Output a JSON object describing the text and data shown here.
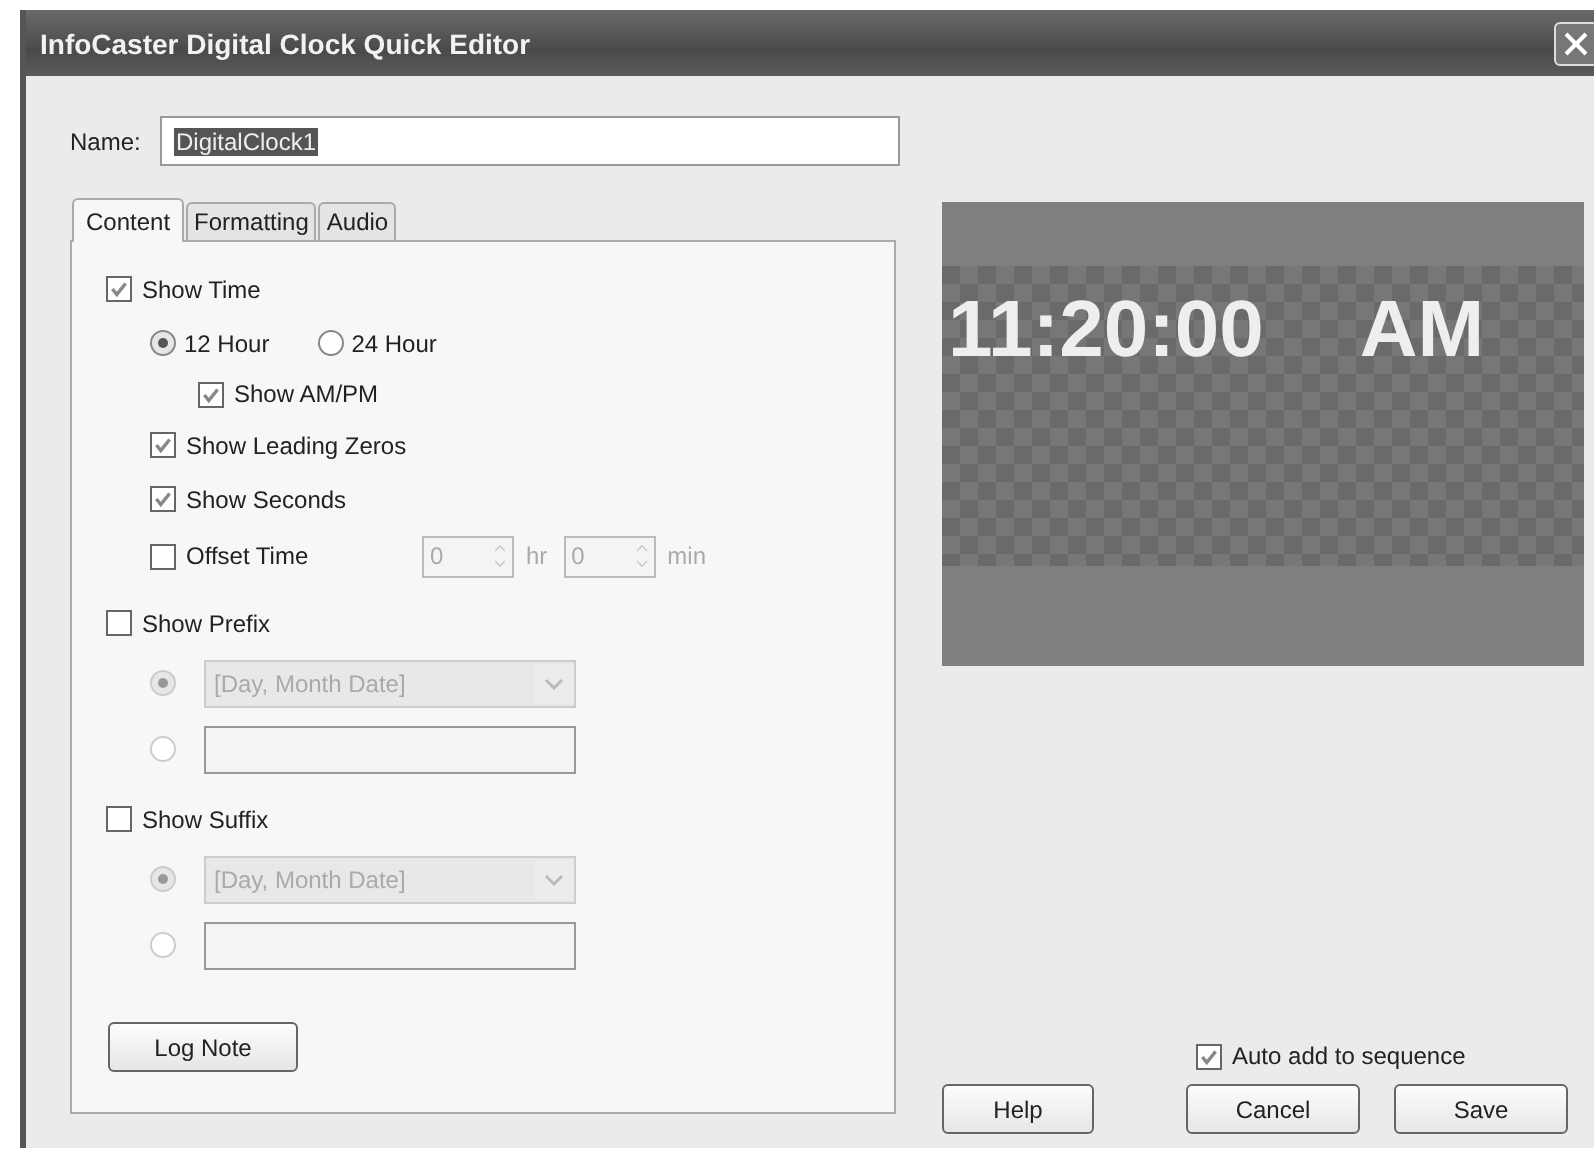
{
  "window": {
    "title": "InfoCaster Digital Clock Quick Editor"
  },
  "name_field": {
    "label": "Name:",
    "value": "DigitalClock1"
  },
  "tabs": [
    {
      "label": "Content",
      "selected": true
    },
    {
      "label": "Formatting",
      "selected": false
    },
    {
      "label": "Audio",
      "selected": false
    }
  ],
  "content": {
    "show_time": {
      "label": "Show Time",
      "checked": true
    },
    "hour_format": [
      {
        "label": "12 Hour",
        "selected": true
      },
      {
        "label": "24 Hour",
        "selected": false
      }
    ],
    "show_ampm": {
      "label": "Show AM/PM",
      "checked": true
    },
    "show_leading_zeros": {
      "label": "Show Leading Zeros",
      "checked": true
    },
    "show_seconds": {
      "label": "Show Seconds",
      "checked": true
    },
    "offset_time": {
      "label": "Offset Time",
      "checked": false,
      "hours": "0",
      "hours_unit": "hr",
      "minutes": "0",
      "minutes_unit": "min"
    },
    "affixes": [
      {
        "label": "Show Prefix",
        "checked": false,
        "options": [
          {
            "kind": "dropdown",
            "value": "[Day, Month Date]",
            "selected": true
          },
          {
            "kind": "text",
            "selected": false
          }
        ]
      },
      {
        "label": "Show Suffix",
        "checked": false,
        "options": [
          {
            "kind": "dropdown",
            "value": "[Day, Month Date]",
            "selected": true
          },
          {
            "kind": "text",
            "selected": false
          }
        ]
      }
    ],
    "log_note_button": "Log Note"
  },
  "preview": {
    "time": "11:20:00",
    "ampm": "AM"
  },
  "auto_add": {
    "label": "Auto add to sequence",
    "checked": true
  },
  "buttons": [
    "Help",
    "Cancel",
    "Save"
  ]
}
